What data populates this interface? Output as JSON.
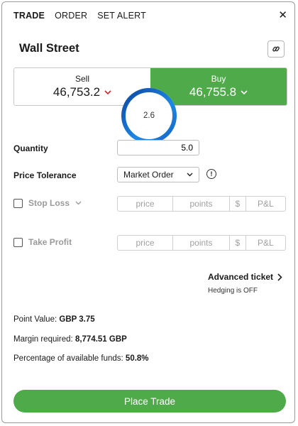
{
  "tabs": [
    {
      "label": "TRADE",
      "active": true
    },
    {
      "label": "ORDER",
      "active": false
    },
    {
      "label": "SET ALERT",
      "active": false
    }
  ],
  "close_label": "✕",
  "market_name": "Wall Street",
  "sell": {
    "label": "Sell",
    "price": "46,753.2"
  },
  "buy": {
    "label": "Buy",
    "price": "46,755.8"
  },
  "spread": "2.6",
  "quantity": {
    "label": "Quantity",
    "value": "5.0"
  },
  "price_tolerance": {
    "label": "Price Tolerance",
    "selected": "Market Order"
  },
  "stop_loss": {
    "label": "Stop Loss",
    "checked": false,
    "fields": [
      "price",
      "points",
      "$",
      "P&L"
    ]
  },
  "take_profit": {
    "label": "Take Profit",
    "checked": false,
    "fields": [
      "price",
      "points",
      "$",
      "P&L"
    ]
  },
  "advanced_ticket": {
    "label": "Advanced ticket",
    "hedging": "Hedging is OFF"
  },
  "info": {
    "point_value_label": "Point Value:",
    "point_value": "GBP 3.75",
    "margin_label": "Margin required:",
    "margin": "8,774.51 GBP",
    "funds_label": "Percentage of available funds:",
    "funds": "50.8%"
  },
  "place_trade_label": "Place Trade",
  "colors": {
    "accent_green": "#4fab4a",
    "sell_arrow": "#c62828",
    "ring_blue": "#1565c0"
  }
}
